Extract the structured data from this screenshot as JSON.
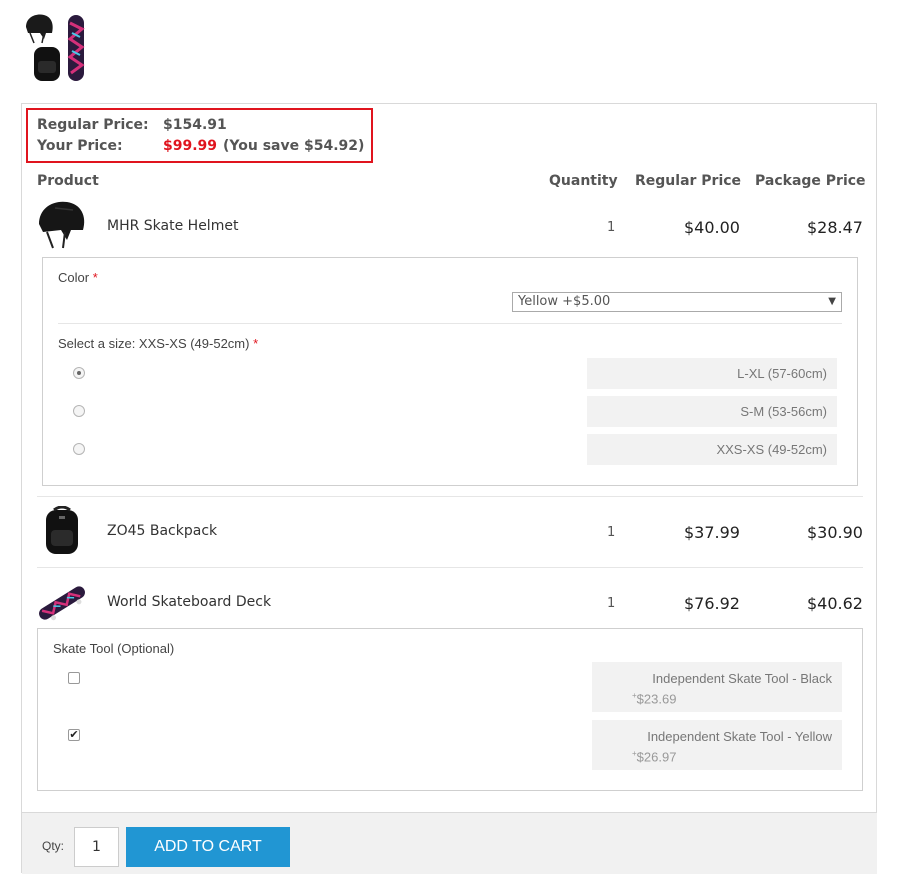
{
  "summary": {
    "regular_price_label": "Regular Price:",
    "regular_price_value": "$154.91",
    "your_price_label": "Your Price:",
    "your_price_value": "$99.99",
    "savings_text": "(You save $54.92)"
  },
  "table": {
    "headers": {
      "product": "Product",
      "quantity": "Quantity",
      "regular_price": "Regular Price",
      "package_price": "Package Price"
    }
  },
  "products": [
    {
      "name": "MHR Skate Helmet",
      "quantity": "1",
      "regular_price": "$40.00",
      "package_price": "$28.47",
      "options": {
        "color_label": "Color",
        "required_mark": "*",
        "color_selected": "Yellow +$5.00",
        "size_label": "Select a size: XXS-XS (49-52cm)",
        "sizes": [
          {
            "label": "L-XL (57-60cm)",
            "selected": true
          },
          {
            "label": "S-M (53-56cm)",
            "selected": false
          },
          {
            "label": "XXS-XS (49-52cm)",
            "selected": false
          }
        ]
      }
    },
    {
      "name": "ZO45 Backpack",
      "quantity": "1",
      "regular_price": "$37.99",
      "package_price": "$30.90"
    },
    {
      "name": "World Skateboard Deck",
      "quantity": "1",
      "regular_price": "$76.92",
      "package_price": "$40.62",
      "options": {
        "tool_label": "Skate Tool (Optional)",
        "tools": [
          {
            "name": "Independent Skate Tool - Black",
            "price": "$23.69",
            "checked": false
          },
          {
            "name": "Independent Skate Tool - Yellow",
            "price": "$26.97",
            "checked": true
          }
        ]
      }
    }
  ],
  "cart": {
    "qty_label": "Qty:",
    "qty_value": "1",
    "add_button": "ADD TO CART"
  },
  "colors": {
    "accent_red": "#e0141e",
    "button_blue": "#2196d3"
  }
}
